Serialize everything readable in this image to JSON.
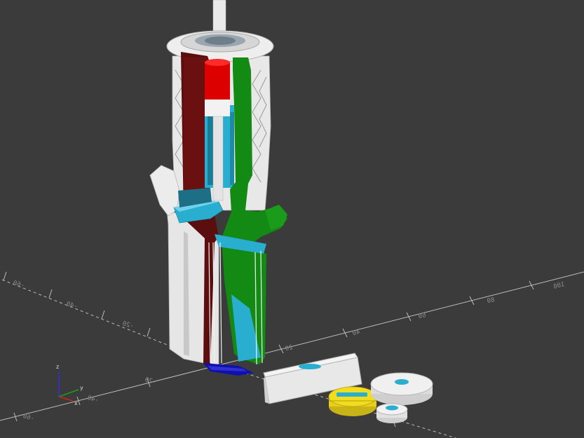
{
  "app": {
    "background": "#3b3b3b",
    "axis_line_color": "#bdbdbd"
  },
  "model_colors": {
    "part_white": "#ececec",
    "cut_red": "#dd0000",
    "cut_dark_red": "#5c0d0d",
    "cut_green": "#138a13",
    "cut_cyan": "#2aaed0",
    "cut_blue": "#1010b0",
    "part_yellow": "#f2dc1e"
  },
  "axis_labels": {
    "x": "x",
    "y": "y",
    "z": "z"
  },
  "scale_ticks": {
    "x_positive": [
      "20",
      "40",
      "60",
      "80",
      "100"
    ],
    "x_negative": [
      "-20",
      "-40",
      "-60"
    ],
    "y_negative": [
      "-20",
      "-40",
      "-60"
    ]
  }
}
